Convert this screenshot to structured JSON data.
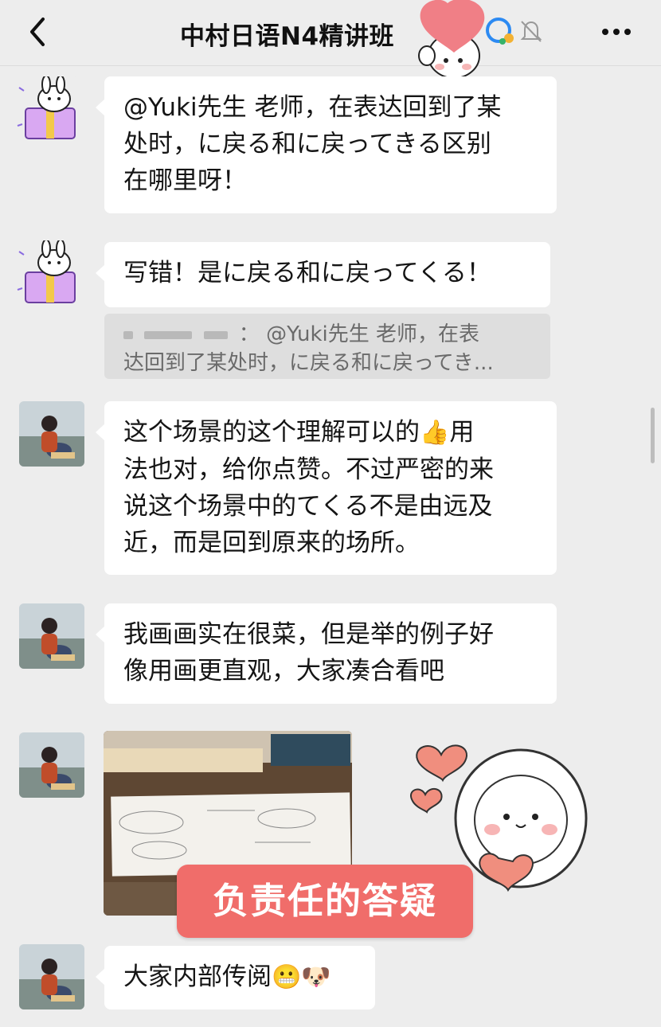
{
  "header": {
    "title": "中村日语N4精讲班"
  },
  "messages": {
    "m1": {
      "lines": [
        "@Yuki先生 老师，在表达回到了某",
        "处时，に戻る和に戻ってきる区别",
        "在哪里呀！"
      ]
    },
    "m2": {
      "text": "写错！是に戻る和に戻ってくる！"
    },
    "m2_quote": {
      "name_masked": "：",
      "line1": "@Yuki先生 老师，在表",
      "line2": "达回到了某处时，に戻る和に戻ってき..."
    },
    "m3": {
      "lines": [
        "这个场景的这个理解可以的",
        "法也对，给你点赞。不过严密的来",
        "说这个场景中的てくる不是由远及",
        "近，而是回到原来的场所。"
      ],
      "line1_tail": "用",
      "emoji": "👍"
    },
    "m4": {
      "lines": [
        "我画画实在很菜，但是举的例子好",
        "像用画更直观，大家凑合看吧"
      ]
    },
    "m6": {
      "text": "大家内部传阅",
      "emoji1": "😬",
      "emoji2": "🐶"
    }
  },
  "overlay": {
    "banner": "负责任的答疑"
  },
  "colors": {
    "background": "#ededed",
    "bubble": "#ffffff",
    "banner": "#f06d6a",
    "heart": "#f08e7e"
  },
  "icons": [
    "back-arrow-icon",
    "more-icon",
    "mute-bell-icon",
    "heart-sticker-icon",
    "bunny-gift-avatar",
    "teacher-avatar"
  ]
}
